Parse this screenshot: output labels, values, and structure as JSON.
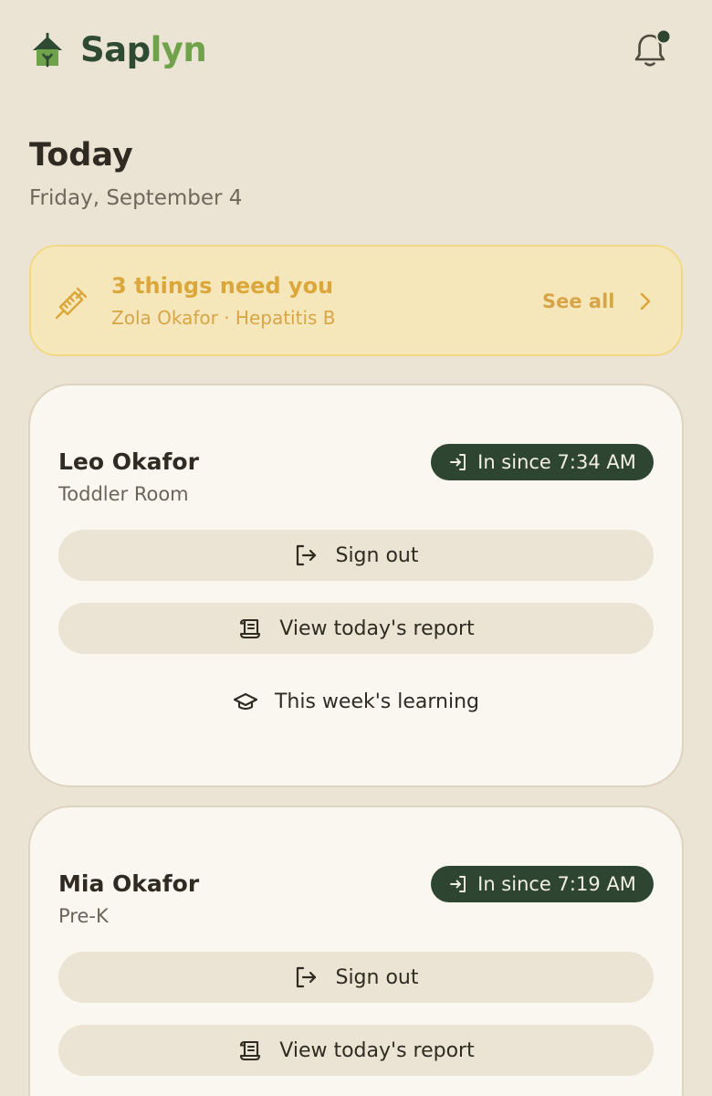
{
  "app": {
    "brand_part1": "Sap",
    "brand_part2": "lyn",
    "colors": {
      "background": "#ebe3d3",
      "brand_dark": "#2f4a33",
      "brand_light": "#6fa24a",
      "alert_bg": "#f6e7bb",
      "alert_text": "#d7a547",
      "status_pill": "#2e4532",
      "card_bg": "#faf7f0"
    },
    "icons": {
      "logo": "schoolhouse-logo-icon",
      "notifications": "bell-icon",
      "notification_badge": "notification-dot"
    }
  },
  "header": {
    "title": "Today",
    "date": "Friday, September 4"
  },
  "alert": {
    "icon": "syringe-icon",
    "title": "3 things need you",
    "subtitle": "Zola Okafor · Hepatitis B",
    "action_label": "See all",
    "action_icon": "chevron-right-icon"
  },
  "children": [
    {
      "name": "Leo Okafor",
      "room": "Toddler Room",
      "status": "In since 7:34 AM",
      "status_icon": "sign-in-arrow-icon",
      "actions": [
        {
          "label": "Sign out",
          "icon": "sign-out-icon"
        },
        {
          "label": "View today's report",
          "icon": "report-scroll-icon"
        },
        {
          "label": "This week's learning",
          "icon": "graduation-cap-icon"
        }
      ]
    },
    {
      "name": "Mia Okafor",
      "room": "Pre-K",
      "status": "In since 7:19 AM",
      "status_icon": "sign-in-arrow-icon",
      "actions": [
        {
          "label": "Sign out",
          "icon": "sign-out-icon"
        },
        {
          "label": "View today's report",
          "icon": "report-scroll-icon"
        }
      ]
    }
  ]
}
